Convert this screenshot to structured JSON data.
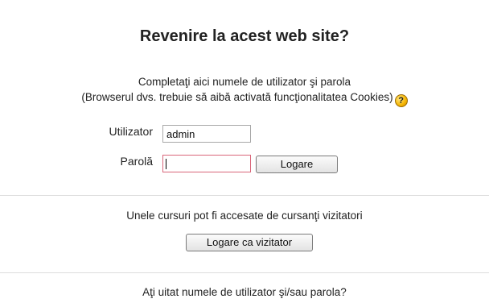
{
  "login": {
    "title": "Revenire la acest web site?",
    "instructions_line1": "Completaţi aici numele de utilizator şi parola",
    "instructions_line2": "(Browserul dvs. trebuie să aibă activată funcţionalitatea Cookies)",
    "help_icon": "help-icon",
    "username_label": "Utilizator",
    "username_value": "admin",
    "password_label": "Parolă",
    "password_value": "",
    "login_button": "Logare"
  },
  "guest": {
    "text": "Unele cursuri pot fi accesate de cursanţi vizitatori",
    "button": "Logare ca vizitator"
  },
  "forgot": {
    "text": "Aţi uitat numele de utilizator şi/sau parola?"
  },
  "colors": {
    "active_input_border": "#d9667a",
    "help_icon": "#f5b400"
  }
}
